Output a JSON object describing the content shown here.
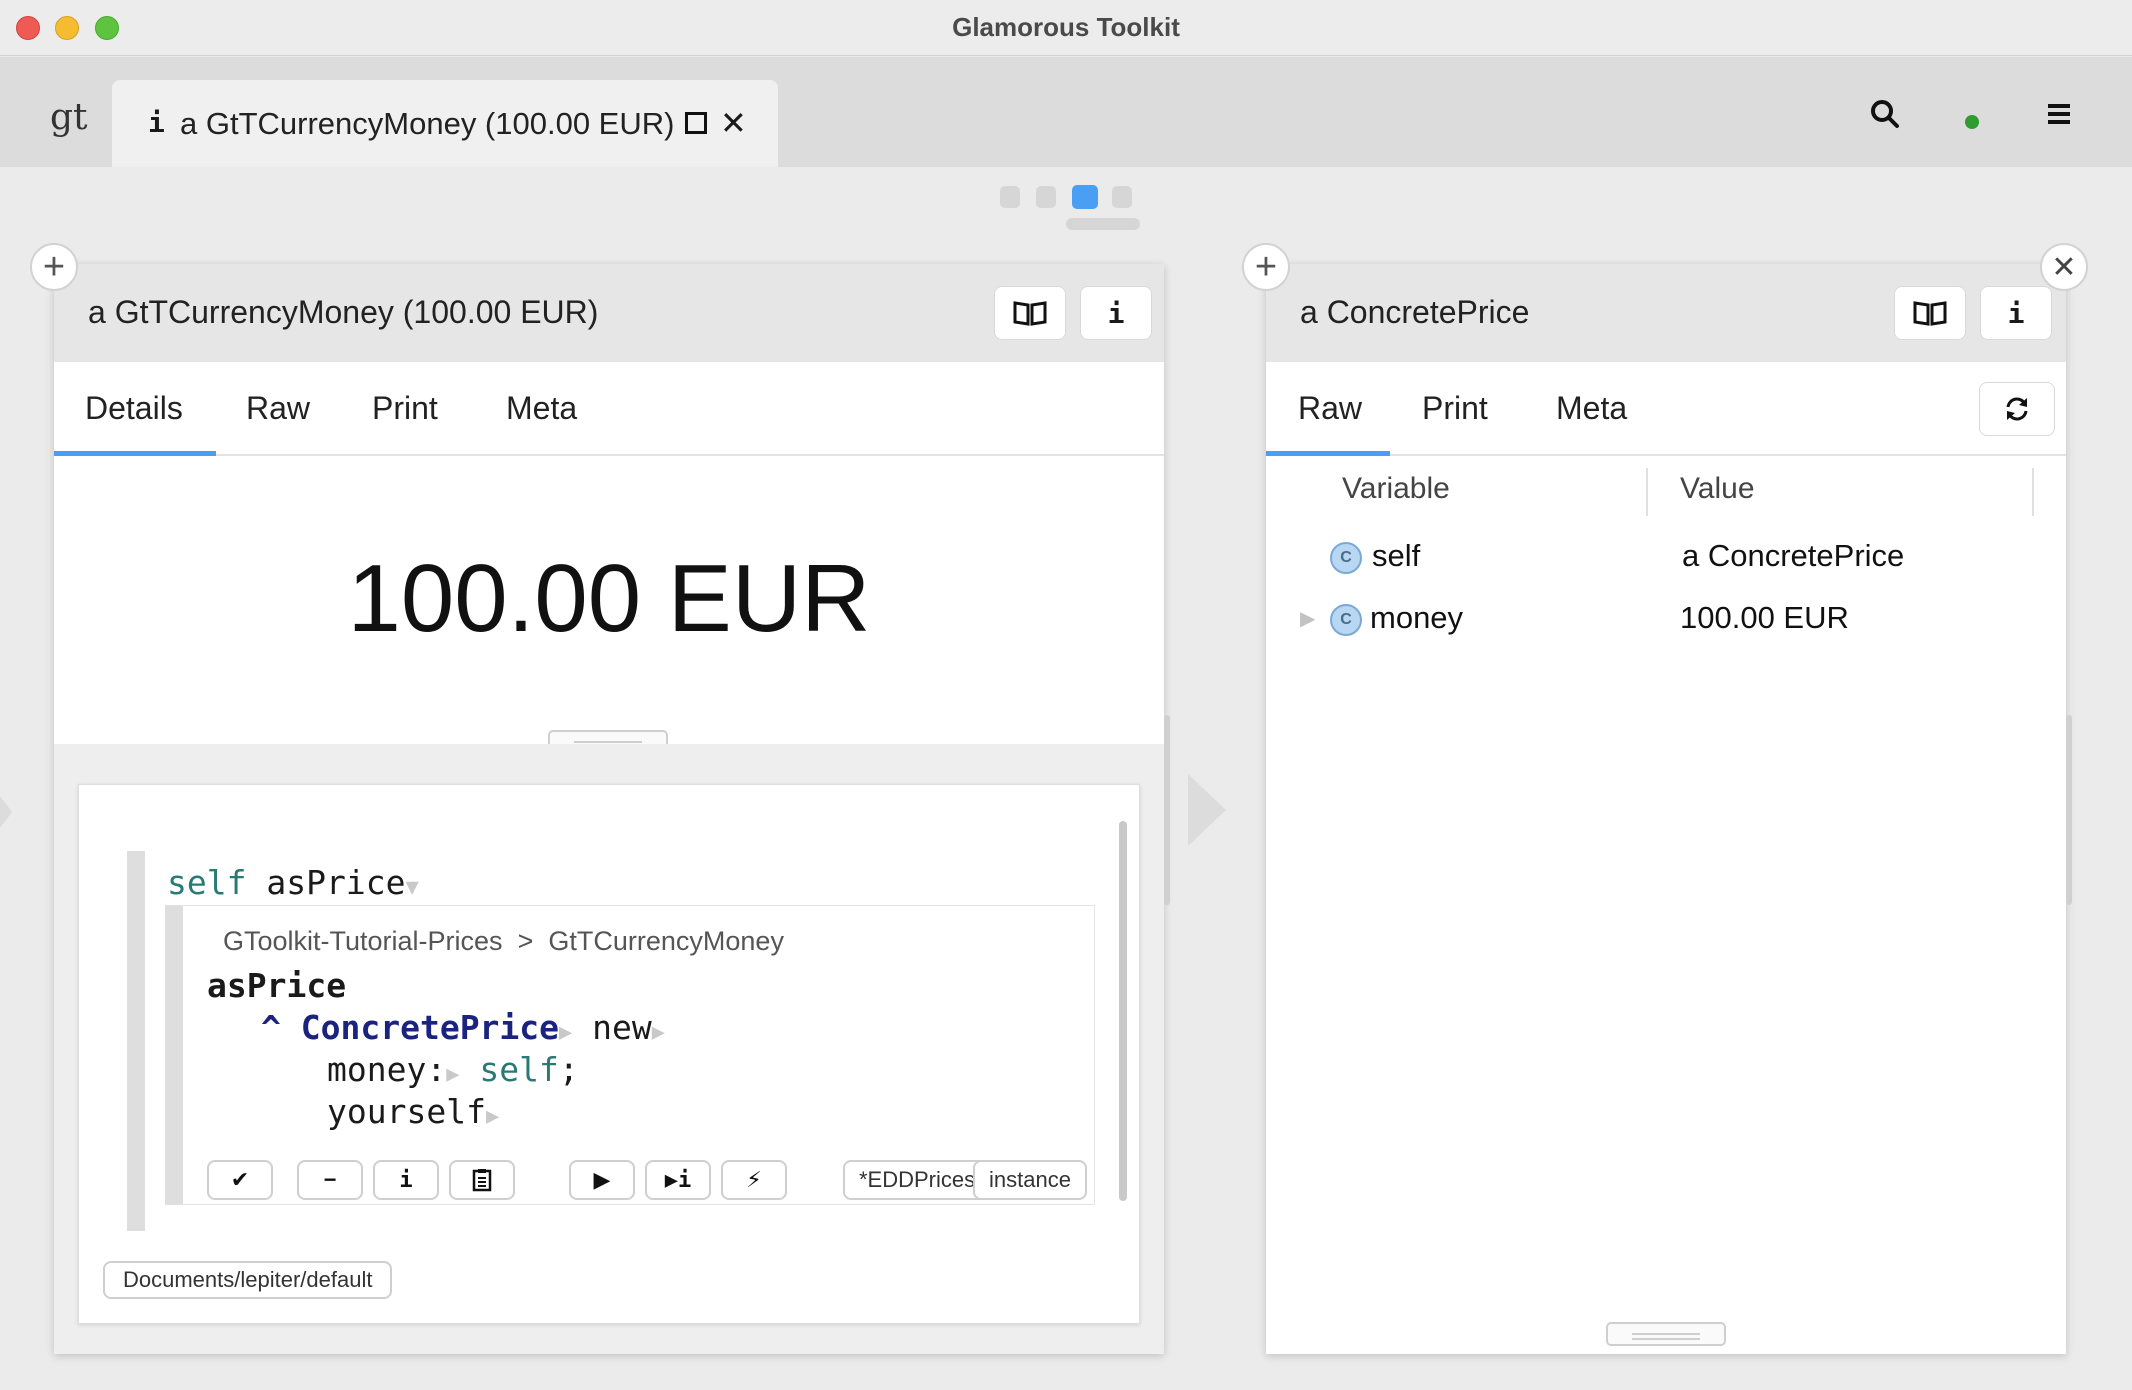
{
  "window": {
    "title": "Glamorous Toolkit"
  },
  "tabbar": {
    "logo": "gt",
    "tab": {
      "icon": "i",
      "label": "a GtTCurrencyMoney (100.00 EUR)"
    }
  },
  "left_pane": {
    "title": "a GtTCurrencyMoney (100.00 EUR)",
    "tabs": [
      "Details",
      "Raw",
      "Print",
      "Meta"
    ],
    "active_tab": "Details",
    "display_value": "100.00 EUR",
    "snippet": {
      "receiver": "self",
      "message": "asPrice",
      "breadcrumb_package": "GToolkit-Tutorial-Prices",
      "breadcrumb_sep": ">",
      "breadcrumb_class": "GtTCurrencyMoney",
      "method_name": "asPrice",
      "code_caret": "^",
      "code_class": "ConcretePrice",
      "code_new": "new",
      "code_money": "money:",
      "code_self": "self",
      "code_semicolon": ";",
      "code_yourself": "yourself",
      "toolbar_labels": {
        "scope": "*EDDPrices",
        "side": "instance"
      }
    },
    "database_path": "Documents/lepiter/default"
  },
  "right_pane": {
    "title": "a ConcretePrice",
    "tabs": [
      "Raw",
      "Print",
      "Meta"
    ],
    "active_tab": "Raw",
    "columns": [
      "Variable",
      "Value"
    ],
    "rows": [
      {
        "variable": "self",
        "value": "a ConcretePrice",
        "expandable": false
      },
      {
        "variable": "money",
        "value": "100.00 EUR",
        "expandable": true
      }
    ]
  },
  "colors": {
    "accent": "#4a9ff5",
    "code_self": "#2a7a74",
    "code_class": "#1a237e",
    "status_ok": "#2e9c2e"
  }
}
